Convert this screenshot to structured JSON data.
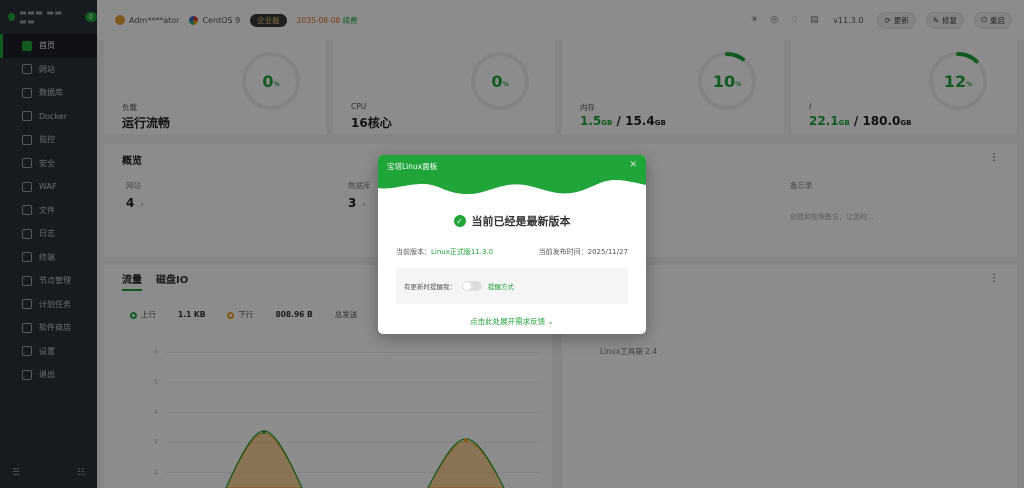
{
  "sidebar": {
    "hostname": "▬▬▬ ▬▬ ▬▬",
    "badge": "0",
    "items": [
      {
        "label": "首页"
      },
      {
        "label": "网站"
      },
      {
        "label": "数据库"
      },
      {
        "label": "Docker"
      },
      {
        "label": "监控"
      },
      {
        "label": "安全"
      },
      {
        "label": "WAF"
      },
      {
        "label": "文件"
      },
      {
        "label": "日志"
      },
      {
        "label": "终端"
      },
      {
        "label": "节点管理"
      },
      {
        "label": "计划任务"
      },
      {
        "label": "软件商店"
      },
      {
        "label": "设置"
      },
      {
        "label": "退出"
      }
    ],
    "bottom_left": "☰",
    "bottom_right": "☷"
  },
  "topbar": {
    "user": "Adm****ator",
    "os": "CentOS 9",
    "edition": "企业版",
    "expiry_date": "2035-08-08",
    "expiry_action": "续费",
    "version": "v11.3.0",
    "buttons": {
      "update": "更新",
      "repair": "修复",
      "restart": "重启"
    }
  },
  "stats": [
    {
      "label": "负载",
      "value": "运行流畅",
      "percent": 0
    },
    {
      "label": "CPU",
      "value": "16核心",
      "percent": 0
    },
    {
      "label": "内存",
      "used": "1.5",
      "used_unit": "GB",
      "total": "15.4",
      "total_unit": "GB",
      "percent": 10
    },
    {
      "label": "/",
      "used": "22.1",
      "used_unit": "GB",
      "total": "180.0",
      "total_unit": "GB",
      "percent": 12
    }
  ],
  "overview": {
    "title": "概览",
    "cells": [
      {
        "label": "网站",
        "value": "4"
      },
      {
        "label": "数据库",
        "value": "3"
      },
      {
        "label": "备忘录",
        "note": "创建和管理备忘，让您的..."
      }
    ]
  },
  "traffic": {
    "tabs": [
      "流量",
      "磁盘IO"
    ],
    "up_label": "上行",
    "up_value": "1.1 KB",
    "down_label": "下行",
    "down_value": "808.96 B",
    "total_sent_label": "总发送",
    "y_ticks": [
      "6",
      "5",
      "4",
      "3",
      "2",
      "1"
    ],
    "side_text": "Linux工具箱 2.4"
  },
  "modal": {
    "title": "宝塔Linux面板",
    "status": "当前已经是最新版本",
    "current_version_label": "当前版本：",
    "current_version": "Linux正式版11.3.0",
    "release_label": "当前发布时间：",
    "release_date": "2025/11/27",
    "remind_label": "有更新时提醒我：",
    "remind_link": "提醒方式",
    "feedback": "点击此处展开需求反馈 ⌄"
  },
  "colors": {
    "accent": "#20a53a",
    "sidebar": "#2b3038",
    "warning": "#e06c2e"
  }
}
